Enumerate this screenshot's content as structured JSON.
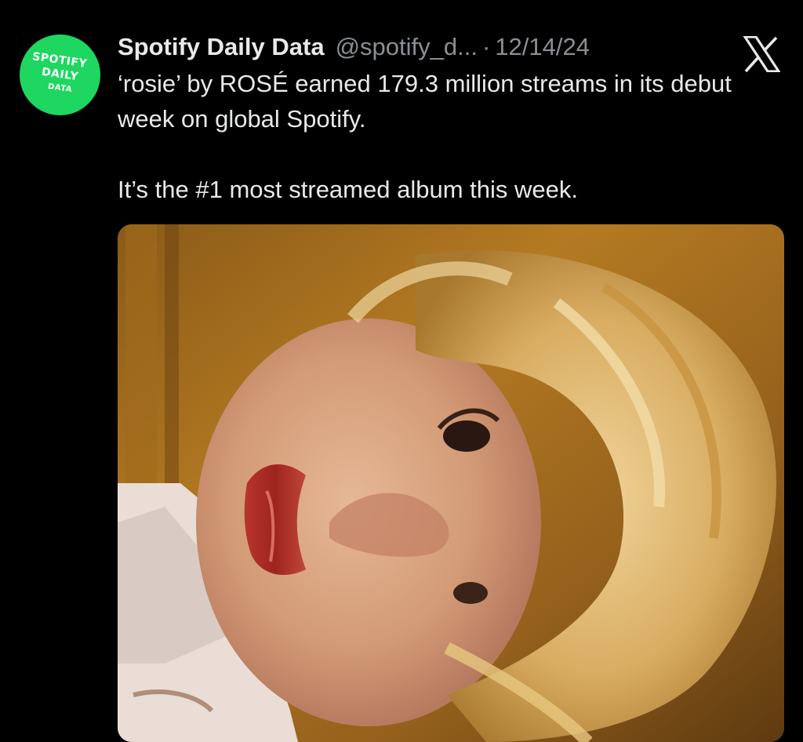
{
  "tweet": {
    "avatar": {
      "line1": "SPOTIFY",
      "line2": "DAILY",
      "line3": "DATA",
      "color": "#1ed760"
    },
    "display_name": "Spotify Daily Data",
    "handle": "@spotify_d...",
    "separator": "·",
    "date": "12/14/24",
    "text_line1": "‘rosie’ by ROSÉ earned 179.3 million streams in its debut week on global Spotify.",
    "text_line2": "It’s the #1 most streamed album this week.",
    "platform_icon": "x-logo-icon"
  },
  "colors": {
    "background": "#000000",
    "text": "#e7e9ea",
    "secondary_text": "#8b8f94"
  }
}
